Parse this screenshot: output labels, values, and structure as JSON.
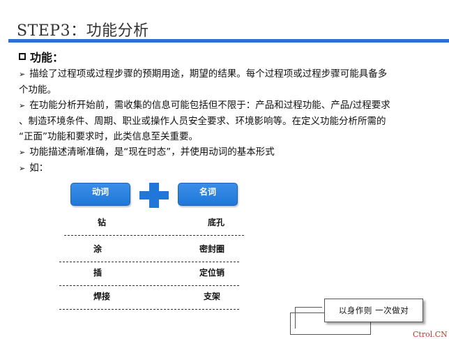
{
  "slide": {
    "title": "STEP3：功能分析",
    "section_heading": "功能：",
    "paragraphs": [
      [
        "描绘了过程项或过程步骤的预期用途，期望的结果。每个过程项或过程步骤可能具备多",
        "个功能。"
      ],
      [
        "在功能分析开始前，需收集的信息可能包括但不限于：产品和过程功能、产品/过程要求",
        "、制造环境条件、周期、职业或操作人员安全要求、环境影响等。在定义功能分析所需的",
        "“正面”功能和要求时，此类信息至关重要。"
      ],
      [
        "功能描述清晰准确，是“现在时态”，并使用动词的基本形式"
      ],
      [
        "如："
      ]
    ]
  },
  "diagram": {
    "verb_label": "动词",
    "noun_label": "名词",
    "rows": [
      {
        "verb": "钻",
        "noun": "底孔"
      },
      {
        "verb": "涂",
        "noun": "密封圈"
      },
      {
        "verb": "插",
        "noun": "定位销"
      },
      {
        "verb": "焊接",
        "noun": "支架"
      }
    ]
  },
  "motto": "以身作则  一次做对",
  "watermark": "Ctrol.CN",
  "colors": {
    "accent": "#2e6fd6",
    "pill": "#2177d8",
    "watermark": "#c0392b"
  },
  "icons": {
    "bullet": "arrowhead-bullet-icon",
    "heading": "hollow-square-icon"
  }
}
